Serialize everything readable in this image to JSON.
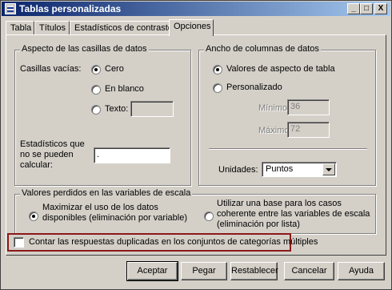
{
  "window": {
    "title": "Tablas personalizadas",
    "controls": {
      "minimize": "_",
      "maximize": "□",
      "close": "X"
    }
  },
  "tabs": [
    "Tabla",
    "Títulos",
    "Estadísticos de contraste",
    "Opciones"
  ],
  "active_tab": "Opciones",
  "empty_cells": {
    "legend": "Aspecto de las casillas de datos",
    "label": "Casillas vacías:",
    "options": [
      "Cero",
      "En blanco",
      "Texto:"
    ],
    "selected": "Cero",
    "text_value": ""
  },
  "uncomputable": {
    "label_line1": "Estadísticos que",
    "label_line2": "no se pueden",
    "label_line3": "calcular:",
    "value": "."
  },
  "column_width": {
    "legend": "Ancho de columnas de datos",
    "options": [
      "Valores de aspecto de tabla",
      "Personalizado"
    ],
    "selected": "Valores de aspecto de tabla",
    "minimum_label": "Mínimo:",
    "minimum_value": "36",
    "maximum_label": "Máximo:",
    "maximum_value": "72",
    "units_label": "Unidades:",
    "units_value": "Puntos"
  },
  "missing": {
    "legend": "Valores perdidos en las variables de escala",
    "option1_line1": "Maximizar el uso de los datos",
    "option1_line2": "disponibles (eliminación por variable)",
    "option2_line1": "Utilizar una base para los casos",
    "option2_line2": "coherente entre las variables de escala",
    "option2_line3": "(eliminación por lista)",
    "selected": 1
  },
  "duplicates_checkbox": {
    "label": "Contar las respuestas duplicadas en los conjuntos de categorías múltiples",
    "checked": false
  },
  "buttons": {
    "ok": "Aceptar",
    "paste": "Pegar",
    "reset": "Restablecer",
    "cancel": "Cancelar",
    "help": "Ayuda"
  },
  "colors": {
    "title_bar_start": "#0a246a",
    "title_bar_end": "#a6caf0",
    "dialog_face": "#d4d0c8",
    "highlight_border": "#8b1a1a"
  }
}
